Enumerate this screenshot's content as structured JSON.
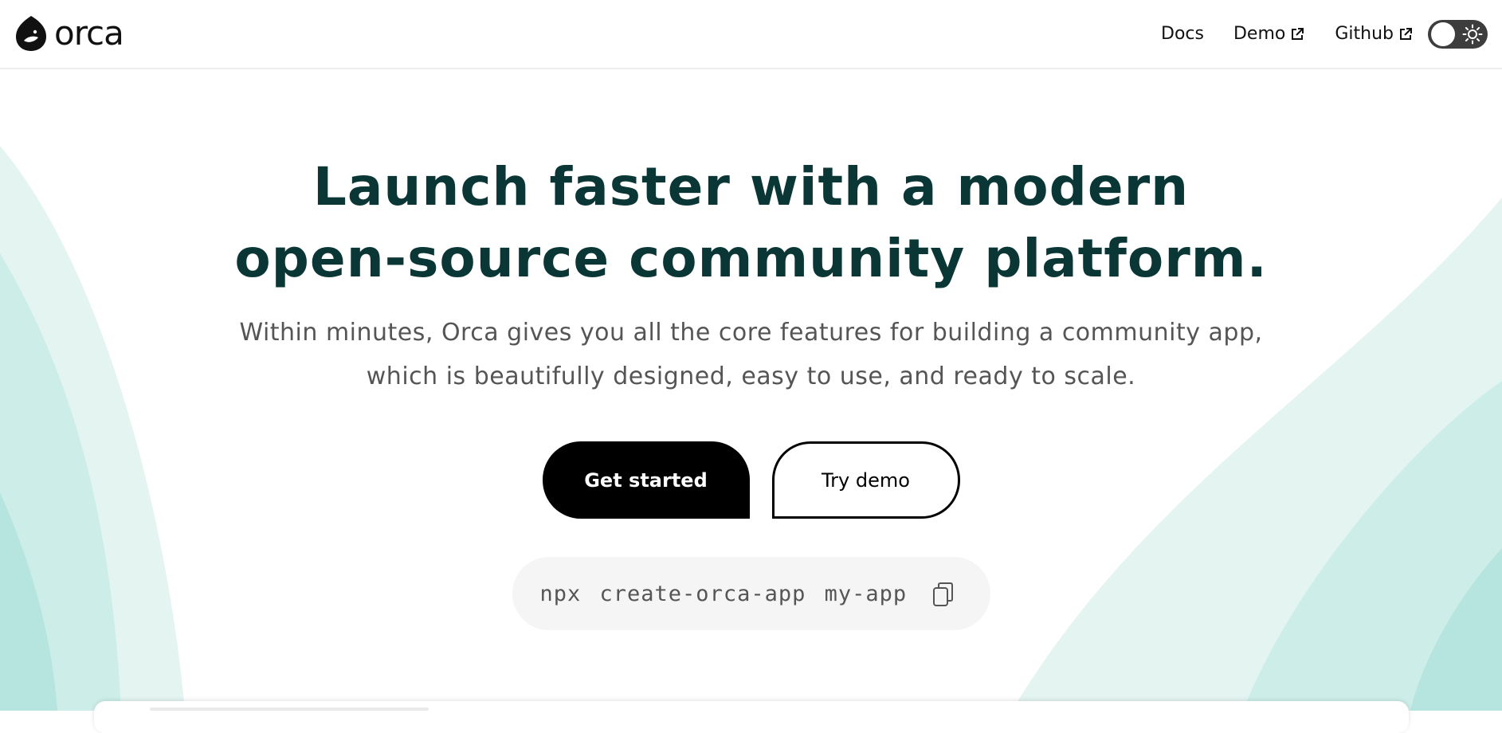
{
  "brand": {
    "name": "orca",
    "logo_icon": "orca-logo-icon"
  },
  "nav": {
    "items": [
      {
        "label": "Docs",
        "external": false
      },
      {
        "label": "Demo",
        "external": true
      },
      {
        "label": "Github",
        "external": true
      }
    ],
    "theme_toggle": {
      "state": "light",
      "icon": "sun-icon"
    }
  },
  "hero": {
    "title_line1": "Launch faster with a modern",
    "title_line2": "open-source community platform.",
    "subtitle_line1": "Within minutes, Orca gives you all the core features for building a community app,",
    "subtitle_line2": "which is beautifully designed, easy to use, and ready to scale.",
    "primary_cta": "Get started",
    "secondary_cta": "Try demo",
    "command": "npx create-orca-app my-app",
    "copy_icon": "copy-icon"
  },
  "colors": {
    "title": "#0b3636",
    "primary_button": "#000000",
    "accent_teal": "#b7e5df",
    "command_bg": "#f5f5f5"
  }
}
